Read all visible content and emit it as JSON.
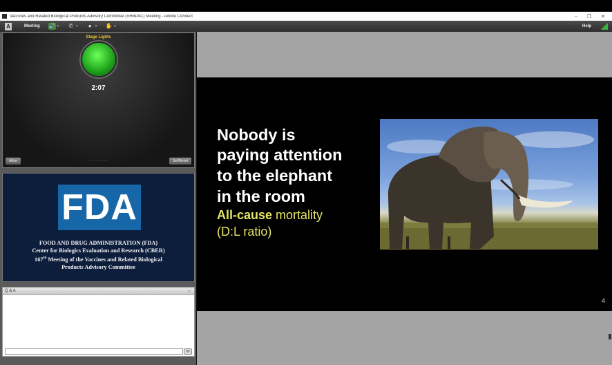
{
  "window": {
    "title": "Vaccines and Related Biological Products Advisory Committee (VRBPAC) Meeting - Adobe Connect",
    "controls": [
      "–",
      "❐",
      "✕"
    ]
  },
  "menubar": {
    "logo_text": "A",
    "meeting_label": "Meeting",
    "help_label": "Help",
    "caret": "▾",
    "speaker_icon": "🔊",
    "phone_icon": "✆",
    "camera_icon": "●",
    "hand_icon": "✋"
  },
  "stage_lights": {
    "title": "Stage Lights",
    "time": "2:07",
    "left_button": "Allow",
    "center_text": "— — — —",
    "right_button": "Set/Reset",
    "light_color": "#1ea31a"
  },
  "fda_pod": {
    "logo": "FDA",
    "line1": "FOOD AND DRUG ADMINISTRATION (FDA)",
    "line2": "Center for Biologics Evaluation and Research (CBER)",
    "line3_num": "167",
    "line3_sup": "th",
    "line3_rest": " Meeting of the Vaccines and Related Biological",
    "line4": "Products Advisory Committee"
  },
  "qa_pod": {
    "header": "Q & A",
    "menu_icon": "≡",
    "send_icon": "✉"
  },
  "slide": {
    "line1": "Nobody is",
    "line2": "paying  attention",
    "line3": "to the elephant",
    "line4": "in  the room",
    "sub_bold": "All-cause",
    "sub_rest": " mortality",
    "sub2": "(D:L ratio)",
    "page_number": "4",
    "text_color": "#ffffff",
    "accent_color": "#e5e565"
  }
}
